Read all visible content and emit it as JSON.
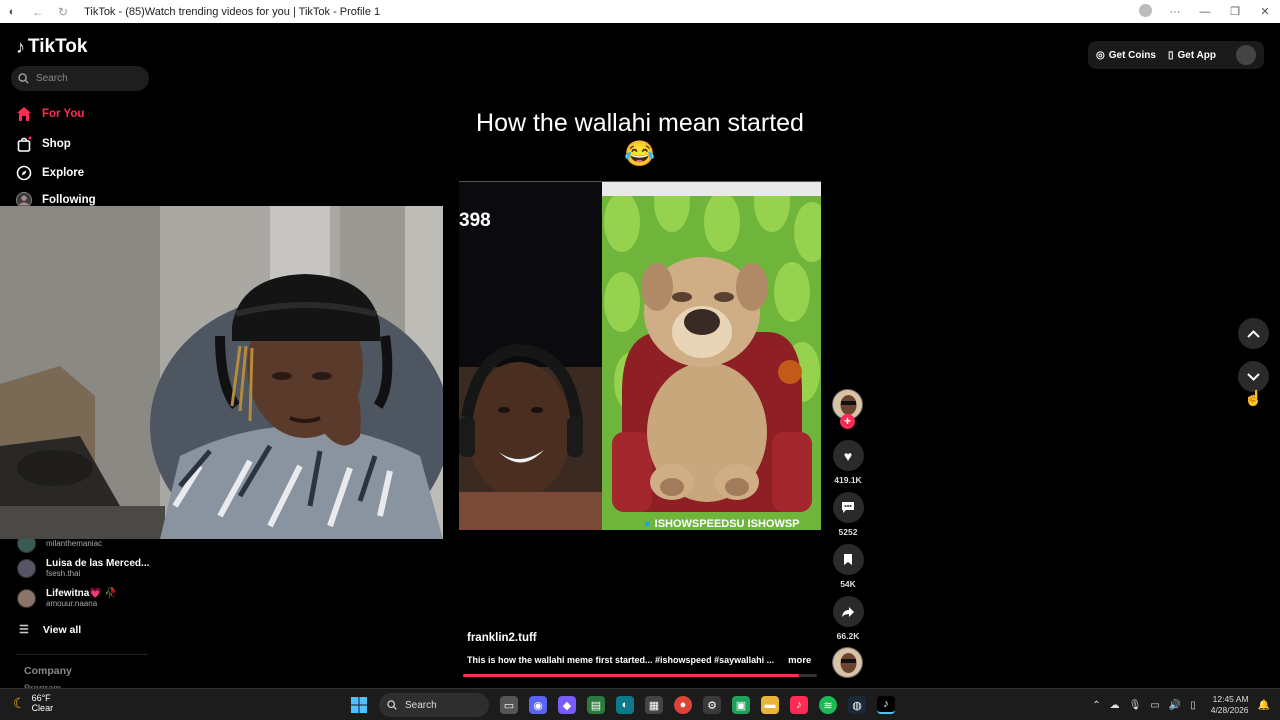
{
  "browser": {
    "title": "TikTok - (85)Watch trending videos for you | TikTok - Profile 1"
  },
  "sidebar": {
    "logo": "TikTok",
    "search_placeholder": "Search",
    "nav": [
      {
        "label": "For You",
        "icon": "home-icon",
        "active": true
      },
      {
        "label": "Shop",
        "icon": "bag-icon"
      },
      {
        "label": "Explore",
        "icon": "compass-icon"
      },
      {
        "label": "Following",
        "icon": "following-avatar-icon"
      }
    ],
    "following_accounts": [
      {
        "name": "",
        "handle": "milanthemaniac"
      },
      {
        "name": "Luisa de las Merced...",
        "handle": "fsesh.thai"
      },
      {
        "name": "Lifewitna💗 🥀",
        "handle": "amouur.naana"
      }
    ],
    "view_all": "View all",
    "company": "Company",
    "program": "Program"
  },
  "header": {
    "get_coins": "Get Coins",
    "get_app": "Get App"
  },
  "video": {
    "title": "How the wallahi mean started 😂",
    "overlay_count": "398",
    "watermark": "ISHOWSPEEDSU ISHOWSP",
    "author": "franklin2.tuff",
    "caption": "This is how the wallahi meme first started... #ishowspeed #saywallahi ...",
    "more": "more",
    "progress": 0.95
  },
  "actions": {
    "likes": "419.1K",
    "comments": "5252",
    "saves": "54K",
    "shares": "66.2K"
  },
  "taskbar": {
    "temperature": "66°F",
    "condition": "Clear",
    "search_label": "Search",
    "time": "12:45 AM",
    "date": "4/28/2026"
  },
  "colors": {
    "accent": "#fe2c55",
    "background": "#000000"
  }
}
